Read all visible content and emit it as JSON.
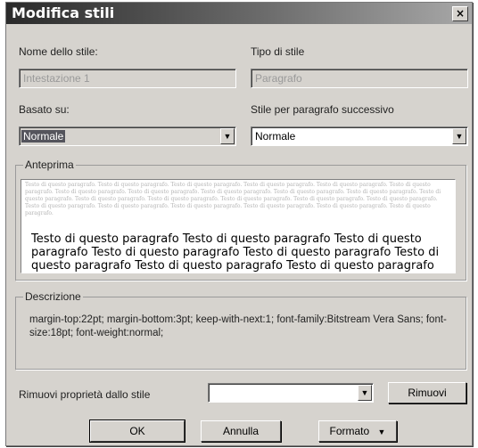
{
  "window": {
    "title": "Modifica stili",
    "close_symbol": "×"
  },
  "style_name": {
    "label": "Nome dello stile:",
    "value": "Intestazione 1"
  },
  "style_type": {
    "label": "Tipo di stile",
    "value": "Paragrafo"
  },
  "based_on": {
    "label": "Basato su:",
    "value": "Normale"
  },
  "next_style": {
    "label": "Stile per paragrafo successivo",
    "value": "Normale"
  },
  "preview": {
    "title": "Anteprima",
    "prev_text": "Testo di questo paragrafo. Testo di questo paragrafo. Testo di questo paragrafo. Testo di questo paragrafo. Testo di questo paragrafo. Testo di questo paragrafo. Testo di questo paragrafo. Testo di questo paragrafo. Testo di questo paragrafo. Testo di questo paragrafo. Testo di questo paragrafo. Testo di questo paragrafo. Testo di questo paragrafo. Testo di questo paragrafo. Testo di questo paragrafo. Testo di questo paragrafo. Testo di questo paragrafo. Testo di questo paragrafo. Testo di questo paragrafo. Testo di questo paragrafo. Testo di questo paragrafo. Testo di questo paragrafo. Testo di questo paragrafo.",
    "main_text": "Testo di questo paragrafo  Testo di questo paragrafo  Testo di questo paragrafo  Testo di questo paragrafo  Testo di questo paragrafo  Testo di questo paragrafo  Testo di questo paragrafo  Testo di questo paragrafo"
  },
  "description": {
    "title": "Descrizione",
    "text": "margin-top:22pt; margin-bottom:3pt; keep-with-next:1; font-family:Bitstream Vera Sans; font-size:18pt; font-weight:normal;"
  },
  "remove_property": {
    "label": "Rimuovi proprietà dallo stile",
    "value": "",
    "button": "Rimuovi"
  },
  "buttons": {
    "ok": "OK",
    "cancel": "Annulla",
    "format": "Formato"
  },
  "icons": {
    "dropdown": "chevron-down-icon",
    "close": "close-icon"
  }
}
